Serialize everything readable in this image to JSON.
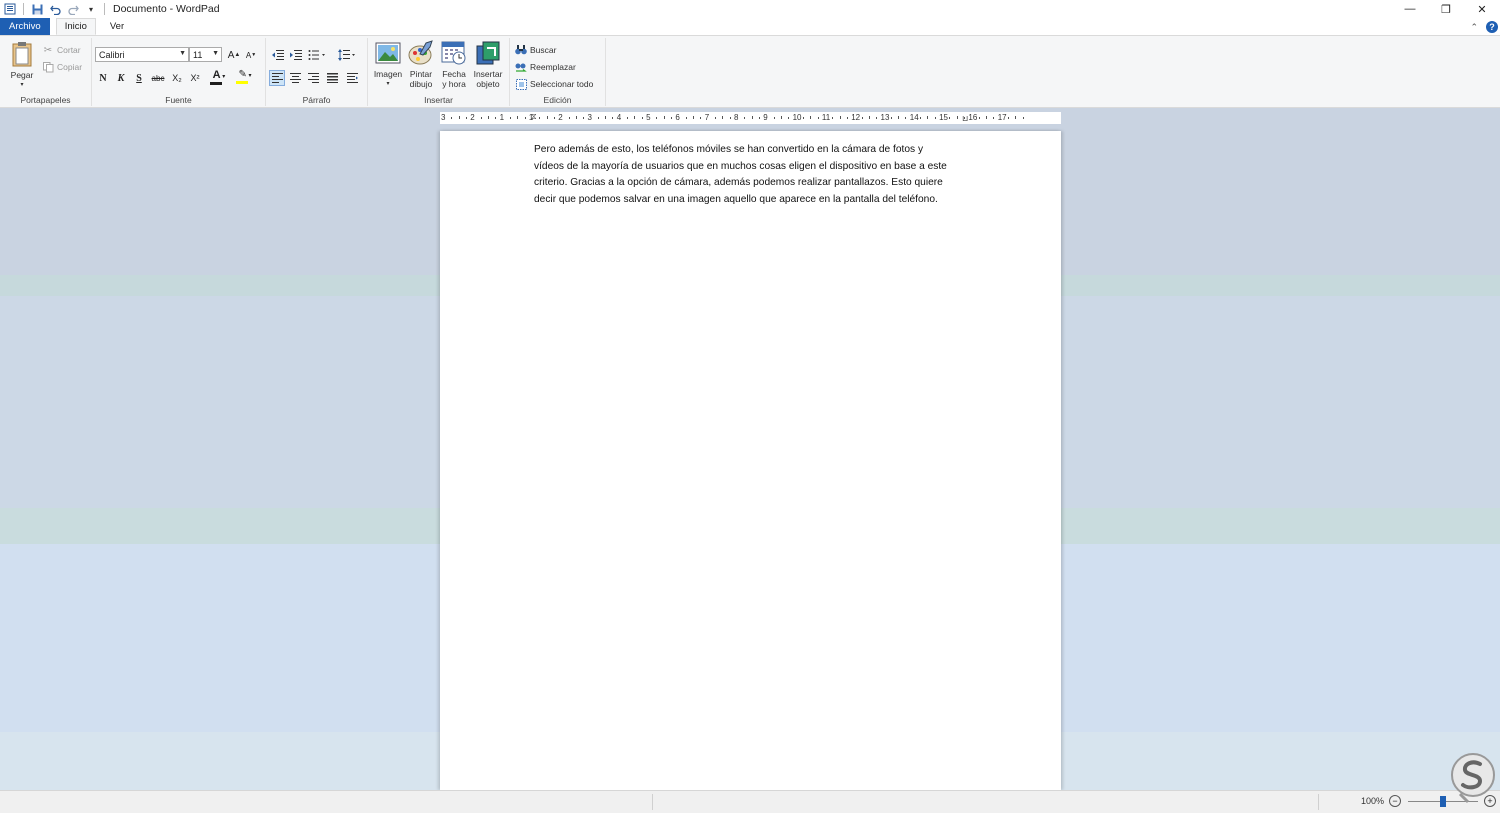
{
  "window": {
    "title": "Documento - WordPad",
    "minimize": "—",
    "restore": "❐",
    "close": "✕"
  },
  "tabs": {
    "file": "Archivo",
    "home": "Inicio",
    "view": "Ver"
  },
  "clipboard": {
    "paste": "Pegar",
    "cut": "Cortar",
    "copy": "Copiar",
    "label": "Portapapeles"
  },
  "font": {
    "family": "Calibri",
    "size": "11",
    "bold": "N",
    "italic": "K",
    "underline": "S",
    "strike": "abc",
    "subscript": "X₂",
    "superscript": "X²",
    "label": "Fuente"
  },
  "paragraph": {
    "label": "Párrafo"
  },
  "insert": {
    "image": "Imagen",
    "paint_line1": "Pintar",
    "paint_line2": "dibujo",
    "date_line1": "Fecha",
    "date_line2": "y hora",
    "object_line1": "Insertar",
    "object_line2": "objeto",
    "label": "Insertar"
  },
  "editing": {
    "find": "Buscar",
    "replace": "Reemplazar",
    "select_all": "Seleccionar todo",
    "label": "Edición"
  },
  "ruler": {
    "labels": [
      "3",
      "2",
      "1",
      "1",
      "2",
      "3",
      "4",
      "5",
      "6",
      "7",
      "8",
      "9",
      "10",
      "11",
      "12",
      "13",
      "14",
      "15",
      "16",
      "17"
    ]
  },
  "document": {
    "text": "Pero además de esto, los teléfonos móviles se han convertido en la cámara de fotos y\nvídeos de la mayoría de usuarios que en muchos cosas eligen el dispositivo en base a este\ncriterio. Gracias a la opción de cámara, además podemos realizar pantallazos. Esto quiere\ndecir que podemos salvar en una imagen aquello que aparece en la pantalla del teléfono."
  },
  "status": {
    "zoom": "100%",
    "zoom_level_percent": 50
  },
  "colors": {
    "accent": "#1e5fb3",
    "font_color_bar": "#1e1e1e",
    "highlight_bar": "#ffff00"
  }
}
